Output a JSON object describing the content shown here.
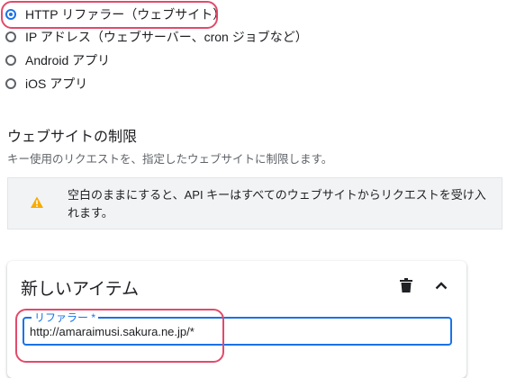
{
  "restrictions": {
    "options": [
      {
        "label": "HTTP リファラー（ウェブサイト）",
        "selected": true
      },
      {
        "label": "IP アドレス（ウェブサーバー、cron ジョブなど）",
        "selected": false
      },
      {
        "label": "Android アプリ",
        "selected": false
      },
      {
        "label": "iOS アプリ",
        "selected": false
      }
    ]
  },
  "website_restrictions": {
    "title": "ウェブサイトの制限",
    "description": "キー使用のリクエストを、指定したウェブサイトに制限します。",
    "warning": "空白のままにすると、API キーはすべてのウェブサイトからリクエストを受け入れます。",
    "warning_icon": "warning-icon",
    "warning_color": "#f9ab00"
  },
  "new_item": {
    "title": "新しいアイテム",
    "delete_icon": "trash-icon",
    "collapse_icon": "chevron-up-icon",
    "referrer_label": "リファラー *",
    "referrer_value": "http://amaraimusi.sakura.ne.jp/*"
  },
  "colors": {
    "accent": "#1a73e8",
    "annotation": "#e24a6a"
  }
}
